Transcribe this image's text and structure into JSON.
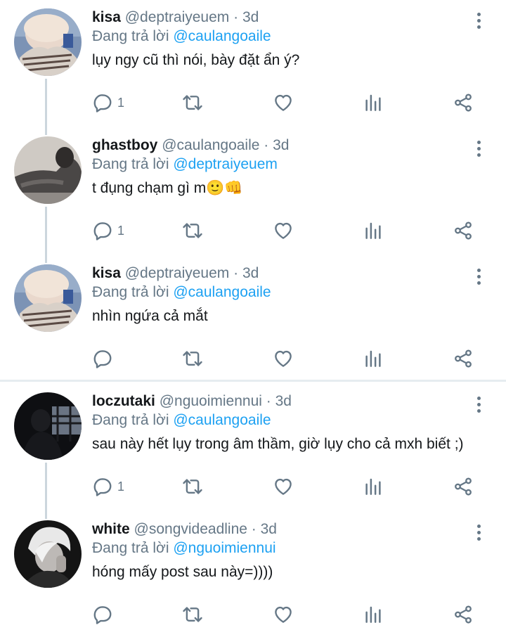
{
  "reply_prefix": "Đang trả lời",
  "colors": {
    "accent": "#1da1f2",
    "muted": "#657786",
    "text": "#14171a",
    "thread_line": "#ccd6dd"
  },
  "tweets": [
    {
      "name": "kisa",
      "handle": "@deptraiyeuem",
      "time": "· 3d",
      "reply_to": "@caulangoaile",
      "text": "lụy ngy cũ thì nói, bày đặt ẩn ý?",
      "reply_count": "1",
      "avatar": "pale-haired-person-with-scarf"
    },
    {
      "name": "ghastboy",
      "handle": "@caulangoaile",
      "time": "· 3d",
      "reply_to": "@deptraiyeuem",
      "text": "t đụng chạm gì m🙂👊",
      "reply_count": "1",
      "avatar": "person-lying-down-grey"
    },
    {
      "name": "kisa",
      "handle": "@deptraiyeuem",
      "time": "· 3d",
      "reply_to": "@caulangoaile",
      "text": "nhìn ngứa cả mắt",
      "reply_count": "",
      "avatar": "pale-haired-person-with-scarf"
    },
    {
      "name": "loczutaki",
      "handle": "@nguoimiennui",
      "time": "· 3d",
      "reply_to": "@caulangoaile",
      "text": "sau này hết lụy trong âm thầm, giờ lụy cho cả mxh biết ;)",
      "reply_count": "1",
      "avatar": "silhouette-at-railing"
    },
    {
      "name": "white",
      "handle": "@songvideadline",
      "time": "· 3d",
      "reply_to": "@nguoimiennui",
      "text": "hóng mấy post sau này=))))",
      "reply_count": "",
      "avatar": "white-haired-person-dark"
    }
  ]
}
